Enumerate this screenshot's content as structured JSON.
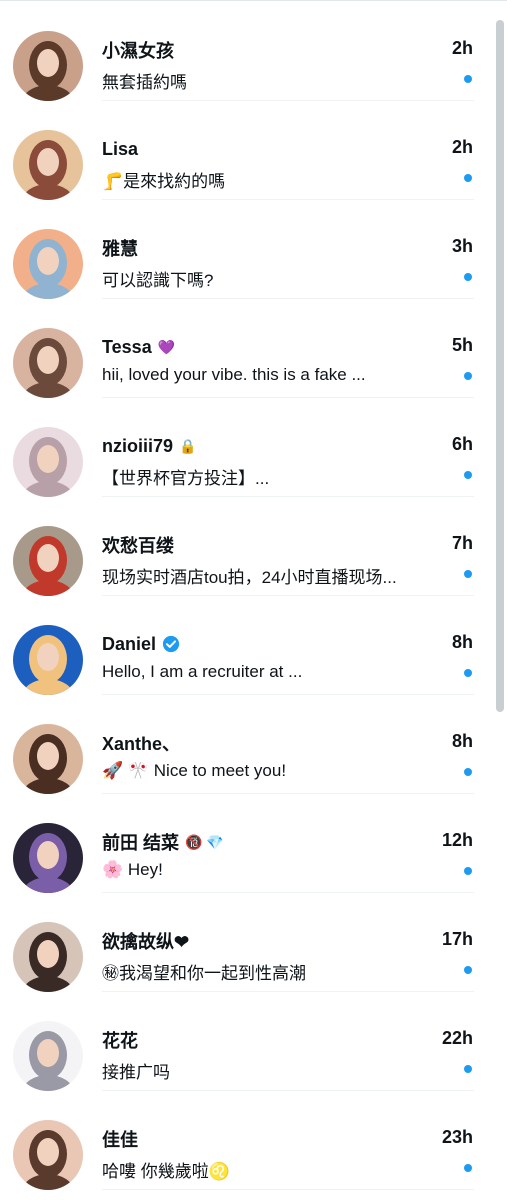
{
  "conversations": [
    {
      "name": "小濕女孩",
      "badge": "",
      "time": "2h",
      "preview": "無套插約嗎",
      "avatar": "avatar-woman-selfie",
      "avatar_colors": [
        "#c9a08a",
        "#5b3a2a"
      ]
    },
    {
      "name": "Lisa",
      "badge": "",
      "time": "2h",
      "preview": "🦵是來找約的嗎",
      "avatar": "avatar-collage",
      "avatar_colors": [
        "#e6c39a",
        "#8a4b3a"
      ]
    },
    {
      "name": "雅慧",
      "badge": "",
      "time": "3h",
      "preview": "可以認識下嗎?",
      "avatar": "avatar-sunset-beach",
      "avatar_colors": [
        "#f2b08a",
        "#8fb3d0"
      ]
    },
    {
      "name": "Tessa",
      "badge": "💜",
      "time": "5h",
      "preview": "hii, loved your vibe. this is a fake ...",
      "avatar": "avatar-woman-lying",
      "avatar_colors": [
        "#d8b3a0",
        "#6b4a3c"
      ]
    },
    {
      "name": "nzioiii79",
      "badge": "🔒",
      "time": "6h",
      "preview": "【世界杯官方投注】...",
      "avatar": "avatar-woman-white",
      "avatar_colors": [
        "#eadbe0",
        "#b8a0a8"
      ]
    },
    {
      "name": "欢愁百缕",
      "badge": "",
      "time": "7h",
      "preview": "现场实时酒店tou拍，24小时直播现场...",
      "avatar": "avatar-room-figures",
      "avatar_colors": [
        "#a89a8a",
        "#c0392b"
      ]
    },
    {
      "name": "Daniel",
      "badge": "verified",
      "time": "8h",
      "preview": "Hello, I am a recruiter at ...",
      "avatar": "avatar-illustrated-man",
      "avatar_colors": [
        "#1d5fbf",
        "#f1c27d"
      ]
    },
    {
      "name": "Xanthe、",
      "badge": "",
      "time": "8h",
      "preview": "🚀 🎌 Nice to meet you!",
      "avatar": "avatar-woman-portrait",
      "avatar_colors": [
        "#d9b59c",
        "#4a2e22"
      ]
    },
    {
      "name": "前田 结菜",
      "badge": "🔞 💎",
      "time": "12h",
      "preview": "🌸 Hey!",
      "avatar": "avatar-woman-dark",
      "avatar_colors": [
        "#2a2438",
        "#7b5ea8"
      ]
    },
    {
      "name": "欲擒故纵❤",
      "badge": "",
      "time": "17h",
      "preview": "㊙我渴望和你一起到性高潮",
      "avatar": "avatar-woman-peace",
      "avatar_colors": [
        "#d7c4b8",
        "#3a2a26"
      ]
    },
    {
      "name": "花花",
      "badge": "",
      "time": "22h",
      "preview": "接推广吗",
      "avatar": "avatar-anime-girl",
      "avatar_colors": [
        "#f4f4f6",
        "#9a9aa6"
      ]
    },
    {
      "name": "佳佳",
      "badge": "",
      "time": "23h",
      "preview": "哈嘍 你幾歲啦♌",
      "avatar": "avatar-woman-closeup",
      "avatar_colors": [
        "#e9c7b4",
        "#5a3a2c"
      ]
    }
  ]
}
